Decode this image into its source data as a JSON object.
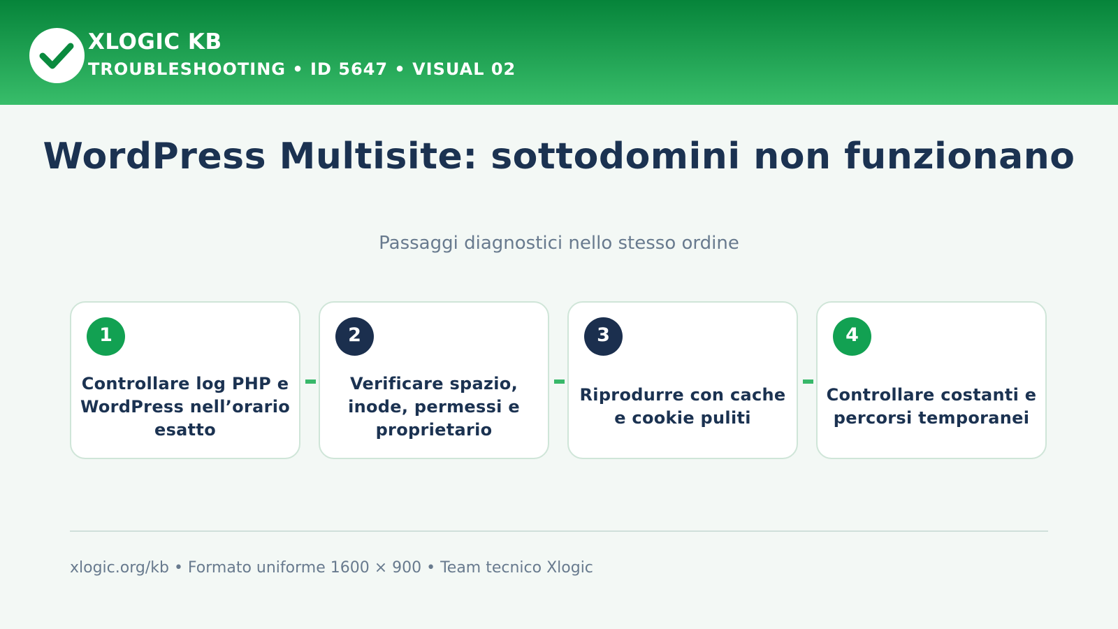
{
  "header": {
    "brand": "XLOGIC KB",
    "breadcrumb": "TROUBLESHOOTING • ID 5647 • VISUAL 02",
    "logo_icon": "checkmark-icon"
  },
  "title": "WordPress Multisite: sottodomini non funzionano",
  "subtitle": "Passaggi diagnostici nello stesso ordine",
  "steps": [
    {
      "number": "1",
      "text": "Controllare log PHP e WordPress nell’orario esatto",
      "badge_color": "#12a152"
    },
    {
      "number": "2",
      "text": "Verificare spazio, inode, permessi e proprietario",
      "badge_color": "#1b2f4e"
    },
    {
      "number": "3",
      "text": "Riprodurre con cache e cookie puliti",
      "badge_color": "#1b2f4e"
    },
    {
      "number": "4",
      "text": "Controllare costanti e percorsi temporanei",
      "badge_color": "#12a152"
    }
  ],
  "footer": "xlogic.org/kb • Formato uniforme 1600 × 900 • Team tecnico Xlogic",
  "colors": {
    "header_start": "#06843a",
    "header_end": "#38bd6a",
    "accent_green": "#12a152",
    "navy": "#1b3251",
    "connector": "#38b86a"
  }
}
